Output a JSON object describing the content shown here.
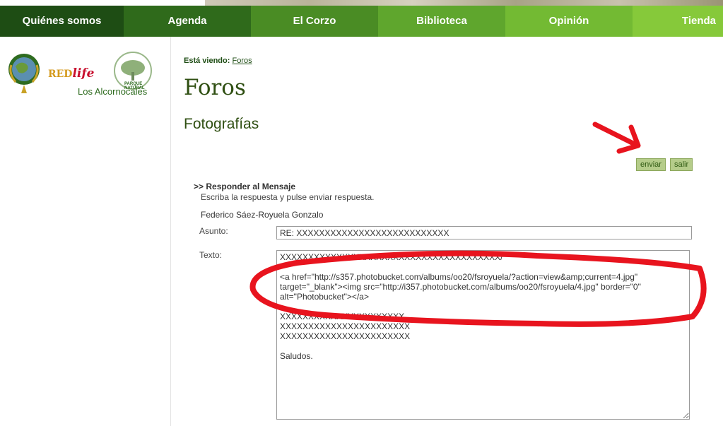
{
  "nav": {
    "items": [
      {
        "label": "Quiénes somos"
      },
      {
        "label": "Agenda"
      },
      {
        "label": "El Corzo"
      },
      {
        "label": "Biblioteca"
      },
      {
        "label": "Opinión"
      },
      {
        "label": "Tienda"
      }
    ]
  },
  "sidebar": {
    "logo_red": "RED",
    "logo_life": "life",
    "logo_park_small": "PARQUE NATURAL",
    "logo_park_name": "Los Alcornocales"
  },
  "main": {
    "viewing_label": "Está viendo:",
    "viewing_link": "Foros",
    "title": "Foros",
    "section": "Fotografías",
    "buttons": {
      "send": "enviar",
      "exit": "salir"
    },
    "reply_heading": ">> Responder al Mensaje",
    "reply_instruction": "Escriba la respuesta y pulse enviar respuesta.",
    "author": "Federico Sáez-Royuela Gonzalo",
    "subject_label": "Asunto:",
    "subject_value": "RE: XXXXXXXXXXXXXXXXXXXXXXXXXXX",
    "text_label": "Texto:",
    "text_value": "XXXXXXXXXXXXXXXXXXXXXXXXXXXXXXXXXXXXXXX/\n\n<a href=\"http://s357.photobucket.com/albums/oo20/fsroyuela/?action=view&amp;current=4.jpg\" target=\"_blank\"><img src=\"http://i357.photobucket.com/albums/oo20/fsroyuela/4.jpg\" border=\"0\" alt=\"Photobucket\"></a>\n\nXXXXXXXXXXXXXXXXXXXXXX\nXXXXXXXXXXXXXXXXXXXXXXX\nXXXXXXXXXXXXXXXXXXXXXXX\n\nSaludos."
  },
  "colors": {
    "annotation_red": "#e8141e",
    "dark_green": "#1e4d14",
    "light_green": "#86c93a"
  }
}
